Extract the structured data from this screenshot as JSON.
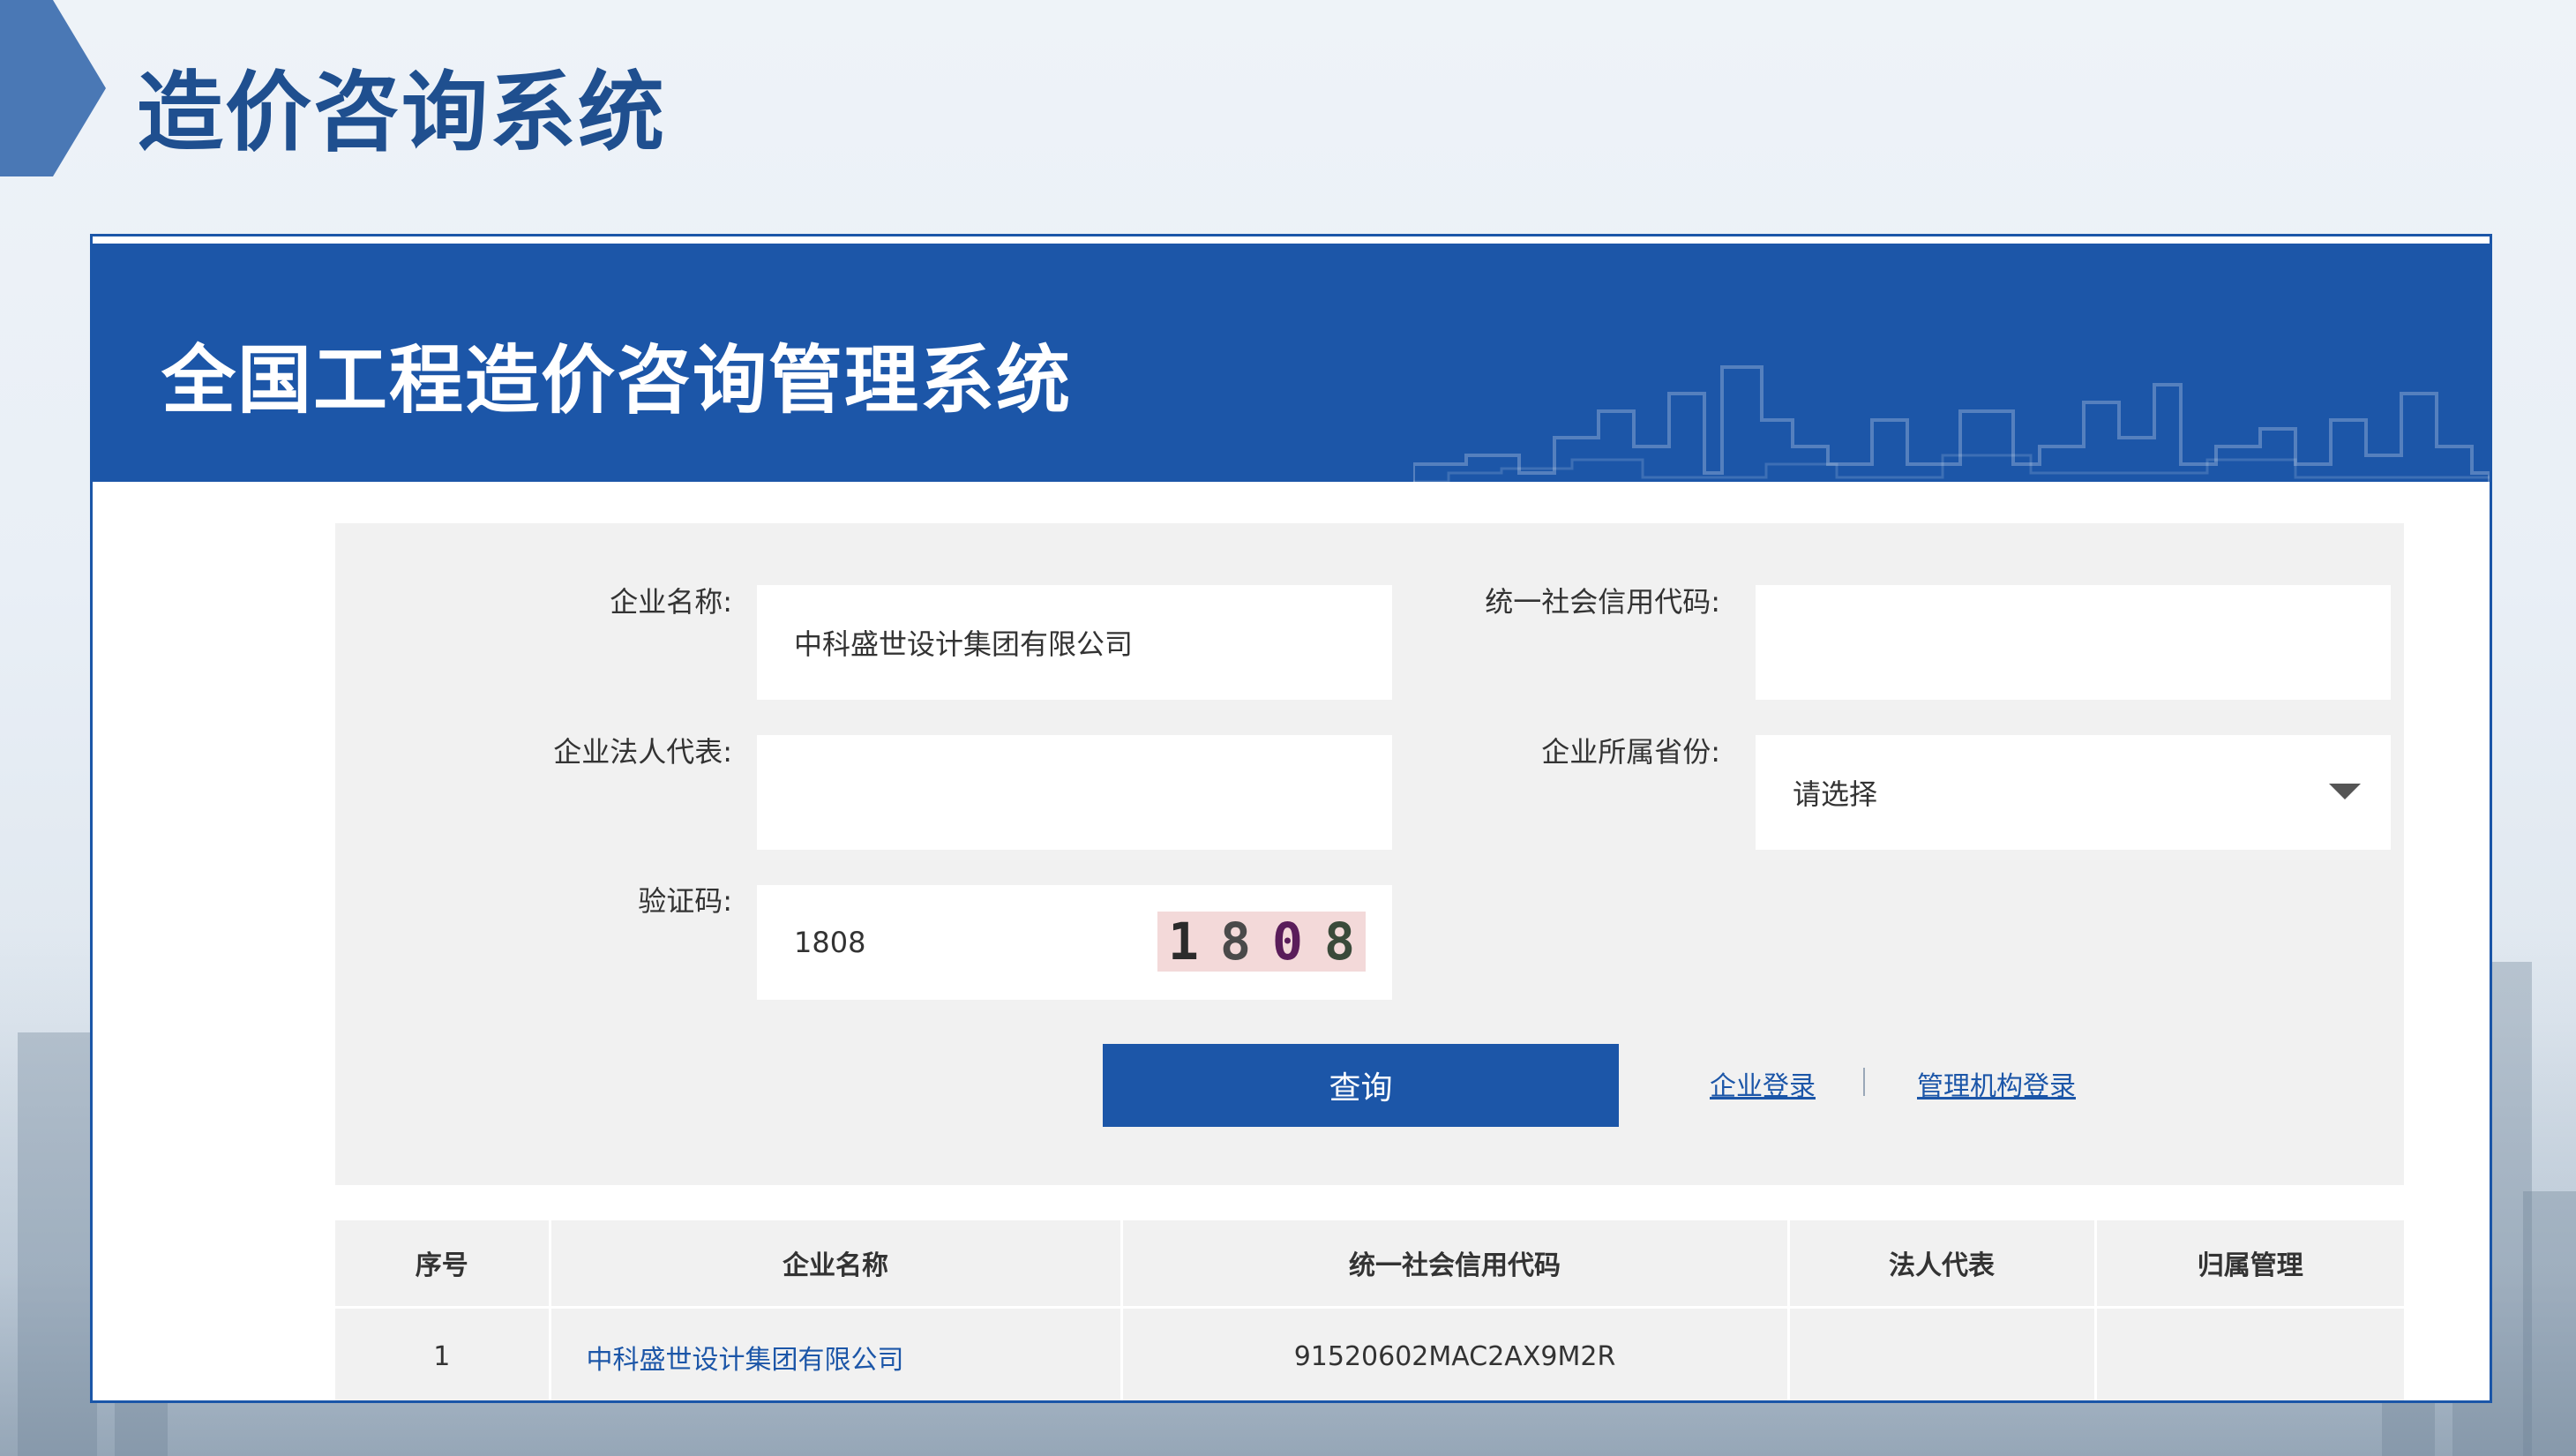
{
  "slide": {
    "title": "造价咨询系统"
  },
  "system": {
    "title": "全国工程造价咨询管理系统"
  },
  "form": {
    "company_name_label": "企业名称:",
    "company_name_value": "中科盛世设计集团有限公司",
    "credit_code_label": "统一社会信用代码:",
    "credit_code_value": "",
    "legal_rep_label": "企业法人代表:",
    "legal_rep_value": "",
    "province_label": "企业所属省份:",
    "province_value": "请选择",
    "captcha_label": "验证码:",
    "captcha_input_value": "1808",
    "captcha_image_digits": [
      "1",
      "8",
      "0",
      "8"
    ],
    "query_button": "查询",
    "company_login_link": "企业登录",
    "agency_login_link": "管理机构登录"
  },
  "table": {
    "headers": [
      "序号",
      "企业名称",
      "统一社会信用代码",
      "法人代表",
      "归属管理"
    ],
    "rows": [
      [
        "1",
        "中科盛世设计集团有限公司",
        "91520602MAC2AX9M2R",
        "",
        ""
      ]
    ]
  },
  "colors": {
    "primary": "#1c56a8",
    "title": "#1f4f8f",
    "panel": "#f1f1f1"
  }
}
